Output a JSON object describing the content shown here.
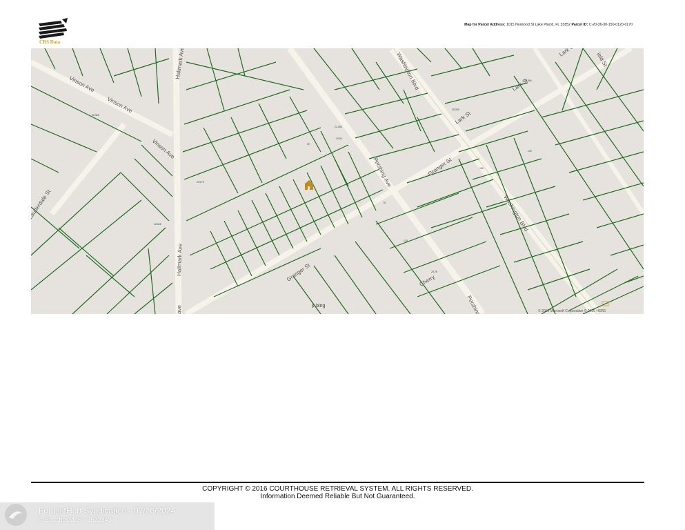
{
  "header": {
    "logo_text": "CRS Data",
    "address_label": "Map for Parcel Address:",
    "address_value": "1015 Norwood St Lake Placid, FL 33852",
    "parcel_label": "Parcel ID:",
    "parcel_value": "C-20-36-30-150-0120-0170"
  },
  "map": {
    "streets": {
      "vinson_ave_1": "Vinson Ave",
      "vinson_ave_2": "Vinson Ave",
      "vinson_ave_3": "Vinson Ave",
      "hallmark_ave_1": "Hallmark Ave",
      "hallmark_ave_2": "Hallmark Ave",
      "hallmark_ave_3": "ave",
      "lauderdale_st": "Lauderdale St",
      "washington_blvd_1": "Washington Blvd",
      "washington_blvd_2": "Washington Blvd",
      "pershing_ave_1": "Pershing Ave",
      "pershing_ave_2": "Pershing Ave",
      "granger_st_1": "Granger St",
      "granger_st_2": "Granger St",
      "lark_st_1": "Lark St",
      "lark_st_2": "Lark St",
      "lark_st_3": "Lark St",
      "field_st": "ield St",
      "cherry": "Cherry"
    },
    "lot_numbers": [
      "35.355",
      "28.355",
      "26.355",
      "22.355",
      "29.89",
      "50",
      "75",
      "150",
      "100",
      "125",
      "223.75",
      "46.608",
      "25.25"
    ],
    "bing_label": "bing",
    "copyright": "© 2016 Microsoft Corporation © 2016 HERE"
  },
  "footer": {
    "copyright_line1": "COPYRIGHT © 2016 COURTHOUSE RETRIEVAL SYSTEM. ALL RIGHTS RESERVED.",
    "copyright_line2": "Information Deemed Reliable But Not Guaranteed."
  },
  "watermark": {
    "line1": "For ListHub Syndication - 07/26/2024",
    "line2": "© BeachesMLS - 1522843"
  },
  "colors": {
    "map_background": "#e6e3de",
    "parcel_lines": "#1e6b1e",
    "roads": "#f4f1e8",
    "logo_accent": "#c9a227",
    "house_marker": "#c08a2a"
  }
}
